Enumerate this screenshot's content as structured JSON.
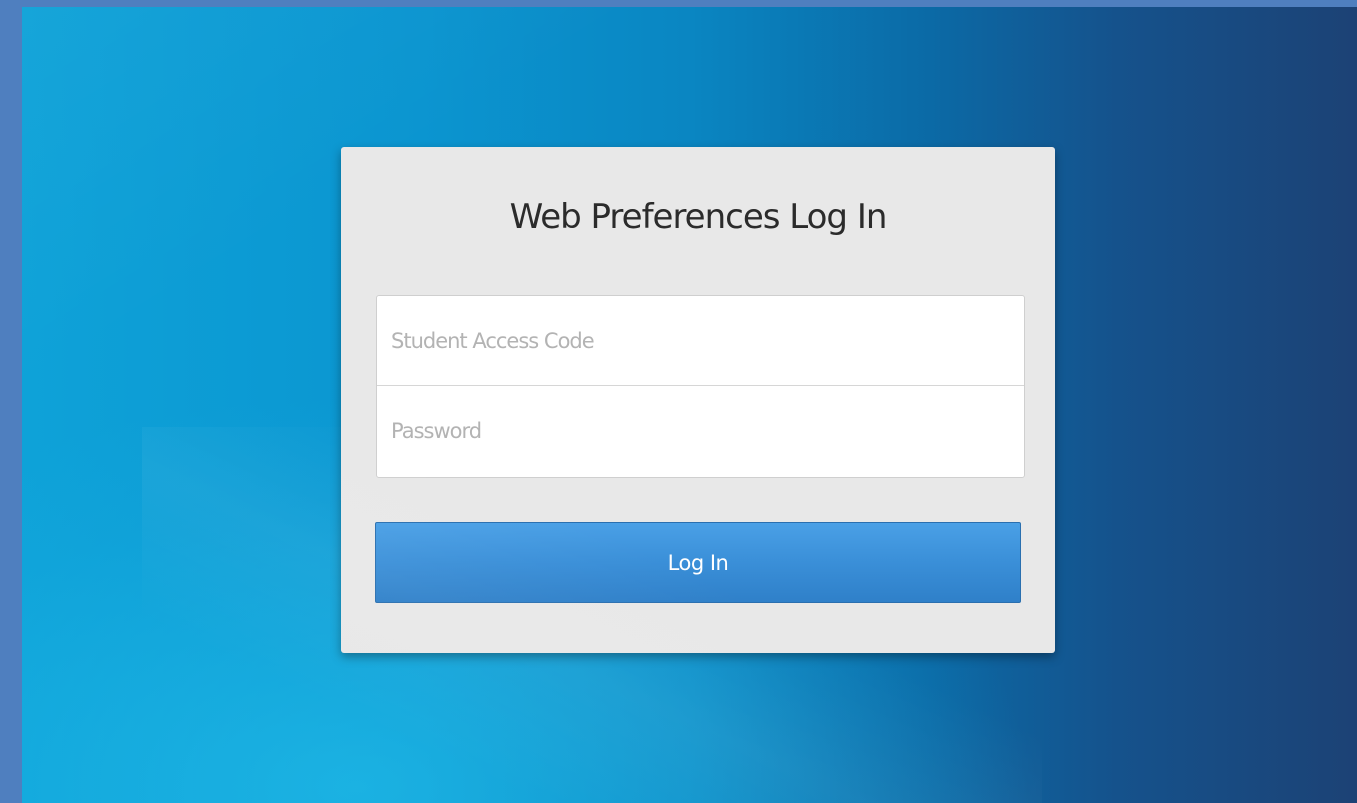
{
  "login": {
    "title": "Web Preferences Log In",
    "student_access_code": {
      "placeholder": "Student Access Code",
      "value": ""
    },
    "password": {
      "placeholder": "Password",
      "value": ""
    },
    "submit_label": "Log In"
  },
  "colors": {
    "background_left": "#0ea2d8",
    "background_right": "#1c4275",
    "card_background": "#e8e8e8",
    "button_primary": "#3a8fd8",
    "page_border": "#4f7fbf"
  }
}
